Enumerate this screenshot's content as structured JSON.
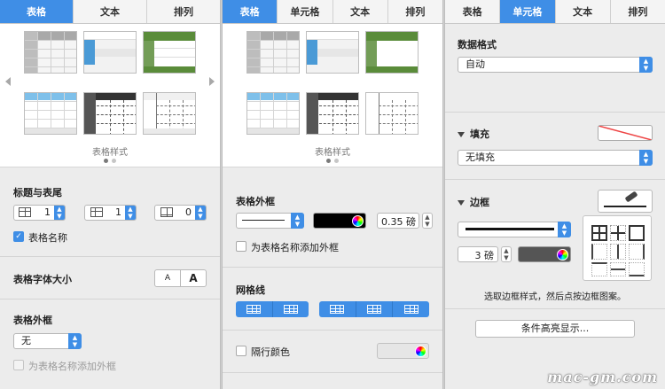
{
  "panel1": {
    "tabs": [
      {
        "label": "表格",
        "active": true
      },
      {
        "label": "文本",
        "active": false
      },
      {
        "label": "排列",
        "active": false
      }
    ],
    "styles_label": "表格样式",
    "header_footer": {
      "title": "标题与表尾",
      "header_rows": "1",
      "header_cols": "1",
      "footer_rows": "0",
      "table_name_checked": true,
      "table_name_label": "表格名称"
    },
    "font_size": {
      "title": "表格字体大小",
      "small_label": "A",
      "large_label": "A"
    },
    "outline": {
      "title": "表格外框",
      "value": "无",
      "add_outline_label": "为表格名称添加外框"
    }
  },
  "panel2": {
    "tabs": [
      {
        "label": "表格",
        "active": true
      },
      {
        "label": "单元格",
        "active": false
      },
      {
        "label": "文本",
        "active": false
      },
      {
        "label": "排列",
        "active": false
      }
    ],
    "styles_label": "表格样式",
    "outline": {
      "title": "表格外框",
      "width": "0.35 磅",
      "add_outline_label": "为表格名称添加外框"
    },
    "gridlines": {
      "title": "网格线"
    },
    "alt_row": {
      "label": "隔行颜色"
    }
  },
  "panel3": {
    "tabs": [
      {
        "label": "表格",
        "active": false
      },
      {
        "label": "单元格",
        "active": true
      },
      {
        "label": "文本",
        "active": false
      },
      {
        "label": "排列",
        "active": false
      }
    ],
    "data_format": {
      "title": "数据格式",
      "value": "自动"
    },
    "fill": {
      "title": "填充",
      "value": "无填充"
    },
    "border": {
      "title": "边框",
      "width": "3 磅",
      "hint": "选取边框样式，然后点按边框图案。"
    },
    "conditional_button": "条件高亮显示..."
  },
  "watermark": "mac-gm.com",
  "colors": {
    "accent": "#3f8ee6",
    "green": "#5a8c3a",
    "blue_header": "#4a9ad6",
    "dark": "#555555"
  }
}
